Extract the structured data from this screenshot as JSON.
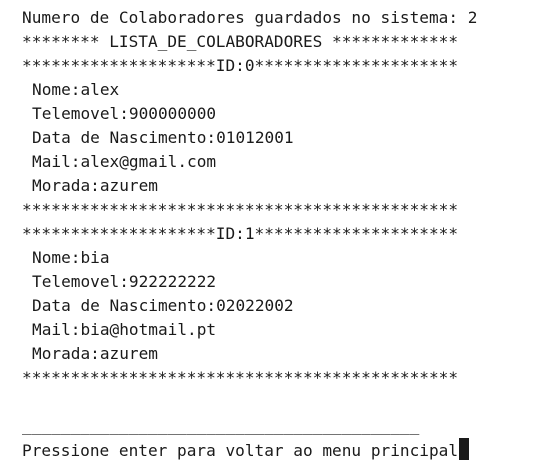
{
  "console": {
    "header": "Numero de Colaboradores guardados no sistema: 2",
    "list_title": "******** LISTA_DE_COLABORADORES *************",
    "records": [
      {
        "id_line": "********************ID:0*********************",
        "nome": "Nome:alex",
        "telemovel": "Telemovel:900000000",
        "nascimento": "Data de Nascimento:01012001",
        "mail": "Mail:alex@gmail.com",
        "morada": "Morada:azurem",
        "separator": "*********************************************"
      },
      {
        "id_line": "********************ID:1*********************",
        "nome": "Nome:bia",
        "telemovel": "Telemovel:922222222",
        "nascimento": "Data de Nascimento:02022002",
        "mail": "Mail:bia@hotmail.pt",
        "morada": "Morada:azurem",
        "separator": "*********************************************"
      }
    ],
    "blank": "",
    "underline": "_________________________________________",
    "prompt": "Pressione enter para voltar ao menu principal"
  }
}
